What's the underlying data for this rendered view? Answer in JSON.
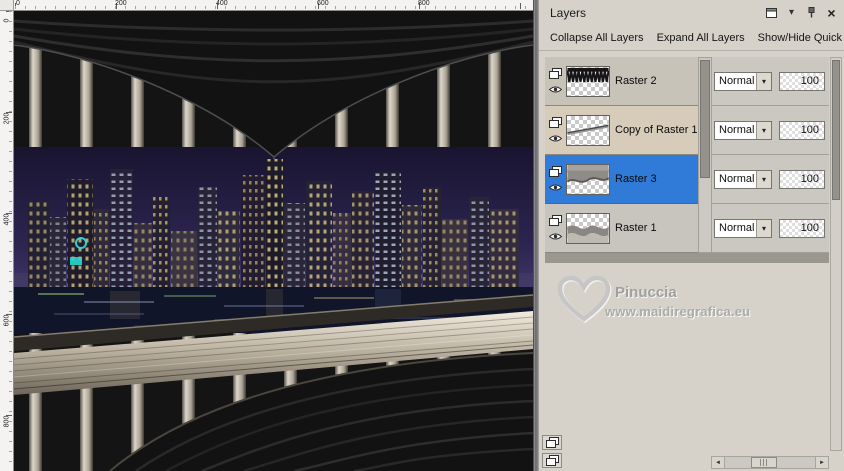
{
  "canvas": {
    "ruler_h_marks": [
      "0",
      "200",
      "400",
      "600",
      "800"
    ],
    "ruler_v_marks": [
      "0",
      "200",
      "400",
      "600",
      "800"
    ]
  },
  "panel": {
    "title": "Layers",
    "toolbar": {
      "collapse_all": "Collapse All Layers",
      "expand_all": "Expand All Layers",
      "show_hide_quick": "Show/Hide Quick"
    },
    "layers": [
      {
        "name": "Raster 2",
        "blend": "Normal",
        "opacity": "100",
        "selected": false
      },
      {
        "name": "Copy of Raster 1",
        "blend": "Normal",
        "opacity": "100",
        "selected": false
      },
      {
        "name": "Raster 3",
        "blend": "Normal",
        "opacity": "100",
        "selected": true
      },
      {
        "name": "Raster 1",
        "blend": "Normal",
        "opacity": "100",
        "selected": false
      }
    ],
    "watermark": {
      "name": "Pinuccia",
      "site": "www.maidiregrafica.eu"
    }
  },
  "icons": {
    "chevron_down": "▾",
    "close": "×",
    "dropdown": "▾",
    "scroll_left": "◄",
    "scroll_right": "►"
  },
  "colors": {
    "selected_row": "#2f7bd7",
    "panel_bg": "#d6d2ca"
  }
}
